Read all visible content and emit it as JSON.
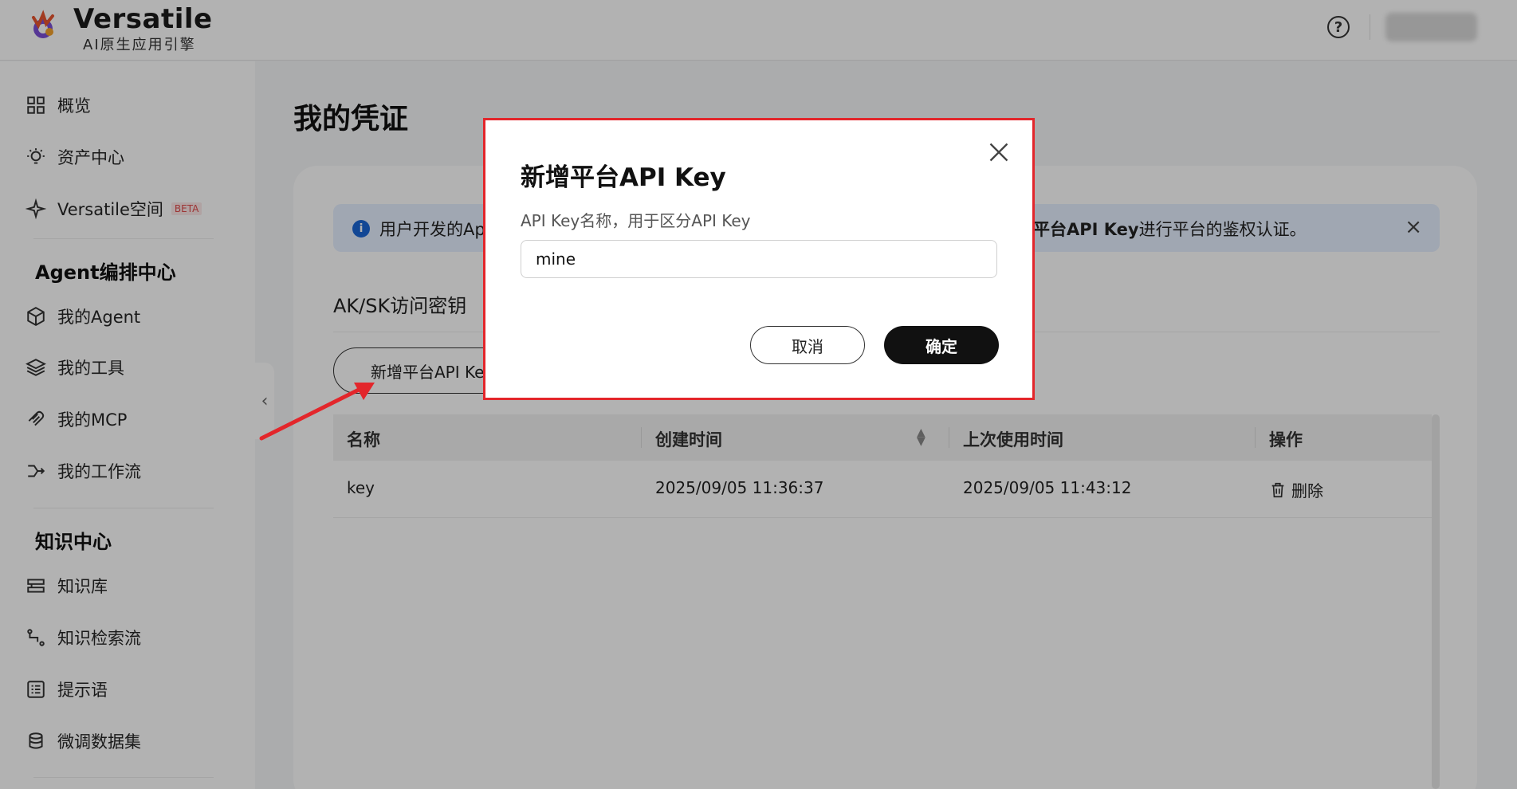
{
  "header": {
    "brand_name": "Versatile",
    "brand_sub": "AI原生应用引擎",
    "help_icon": "?"
  },
  "sidebar": {
    "items": [
      {
        "label": "概览",
        "icon": "grid-icon"
      },
      {
        "label": "资产中心",
        "icon": "bulb-icon"
      },
      {
        "label": "Versatile空间",
        "icon": "sparkle-icon",
        "badge": "BETA"
      }
    ],
    "group_agent": "Agent编排中心",
    "agent_items": [
      {
        "label": "我的Agent",
        "icon": "cube-icon"
      },
      {
        "label": "我的工具",
        "icon": "layers-icon"
      },
      {
        "label": "我的MCP",
        "icon": "mcp-icon"
      },
      {
        "label": "我的工作流",
        "icon": "flow-icon"
      }
    ],
    "group_knowledge": "知识中心",
    "knowledge_items": [
      {
        "label": "知识库",
        "icon": "database-icon"
      },
      {
        "label": "知识检索流",
        "icon": "branch-icon"
      },
      {
        "label": "提示语",
        "icon": "list-icon"
      },
      {
        "label": "微调数据集",
        "icon": "stack-icon"
      }
    ],
    "collapse": "‹"
  },
  "main": {
    "page_title": "我的凭证",
    "alert": {
      "text_left": "用户开发的Ap",
      "text_right_bold": "平台API Key",
      "text_right_rest": "进行平台的鉴权认证。",
      "close": "×"
    },
    "section_title": "AK/SK访问密钥",
    "add_button": "新增平台API Key",
    "table": {
      "headers": [
        "名称",
        "创建时间",
        "上次使用时间",
        "操作"
      ],
      "rows": [
        {
          "name": "key",
          "created": "2025/09/05 11:36:37",
          "last_used": "2025/09/05 11:43:12",
          "action": "删除"
        }
      ]
    }
  },
  "modal": {
    "title": "新增平台API Key",
    "label": "API Key名称，用于区分API Key",
    "input_value": "mine",
    "cancel": "取消",
    "ok": "确定"
  },
  "colors": {
    "accent": "#1b66d6",
    "highlight": "#e3262b",
    "primary_button": "#111111"
  }
}
